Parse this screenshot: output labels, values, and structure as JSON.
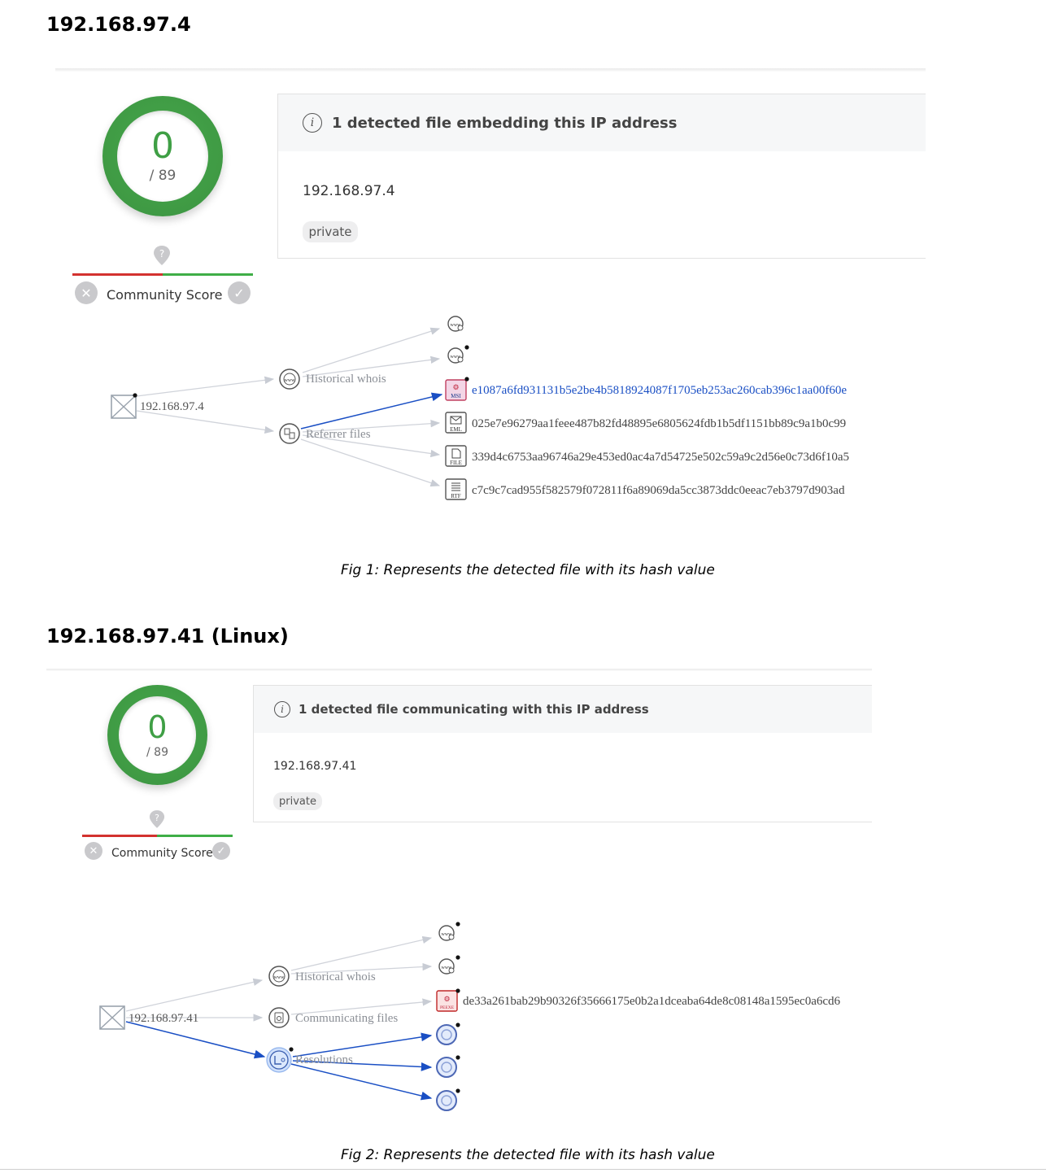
{
  "section1": {
    "title": "192.168.97.4",
    "score": {
      "value": "0",
      "total": "/ 89",
      "community_label": "Community Score"
    },
    "info": {
      "heading": "1 detected file embedding this IP address",
      "ip": "192.168.97.4",
      "tag": "private"
    },
    "graph": {
      "root_label": "192.168.97.4",
      "relations": [
        "Historical whois",
        "Referrer files"
      ],
      "files": [
        {
          "badge": "MSI",
          "hash": "e1087a6fd931131b5e2be4b5818924087f1705eb253ac260cab396c1aa00f60e",
          "highlight": true
        },
        {
          "badge": "EML",
          "hash": "025e7e96279aa1feee487b82fd48895e6805624fdb1b5df1151bb89c9a1b0c99",
          "highlight": false
        },
        {
          "badge": "FILE",
          "hash": "339d4c6753aa96746a29e453ed0ac4a7d54725e502c59a9c2d56e0c73d6f10a5",
          "highlight": false
        },
        {
          "badge": "RTF",
          "hash": "c7c9c7cad955f582579f072811f6a89069da5cc3873ddc0eeac7eb3797d903ad",
          "highlight": false
        }
      ]
    },
    "caption": "Fig 1: Represents the detected file with its hash value"
  },
  "section2": {
    "title": "192.168.97.41 (Linux)",
    "score": {
      "value": "0",
      "total": "/ 89",
      "community_label": "Community Score"
    },
    "info": {
      "heading": "1 detected file communicating with this IP address",
      "ip": "192.168.97.41",
      "tag": "private"
    },
    "graph": {
      "root_label": "192.168.97.41",
      "relations": [
        "Historical whois",
        "Communicating files",
        "Resolutions"
      ],
      "files": [
        {
          "badge": "PEEXE",
          "hash": "de33a261bab29b90326f35666175e0b2a1dceaba64de8c08148a1595ec0a6cd6"
        }
      ]
    },
    "caption": "Fig 2: Represents the detected file with its hash value"
  },
  "colors": {
    "accent_green": "#3f9f45",
    "bad_red": "#d3322f",
    "link_blue": "#1a4fc4",
    "edge_gray": "#c8ccd4"
  }
}
